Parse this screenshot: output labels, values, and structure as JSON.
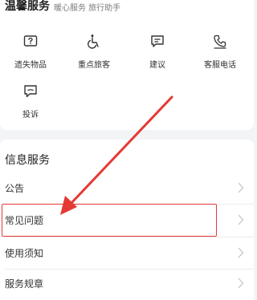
{
  "warm_service": {
    "title": "温馨服务",
    "subtitle": "暖心服务 旅行助手",
    "items": [
      {
        "label": "遗失物品",
        "icon": "lost-item-icon"
      },
      {
        "label": "重点旅客",
        "icon": "wheelchair-icon"
      },
      {
        "label": "建议",
        "icon": "suggestion-icon"
      },
      {
        "label": "客服电话",
        "icon": "phone-icon"
      },
      {
        "label": "投诉",
        "icon": "complaint-icon"
      }
    ]
  },
  "info_service": {
    "title": "信息服务",
    "rows": [
      {
        "label": "公告"
      },
      {
        "label": "常见问题"
      },
      {
        "label": "使用须知"
      },
      {
        "label": "服务规章"
      }
    ]
  },
  "annotation": {
    "highlight_color": "#e53935"
  }
}
